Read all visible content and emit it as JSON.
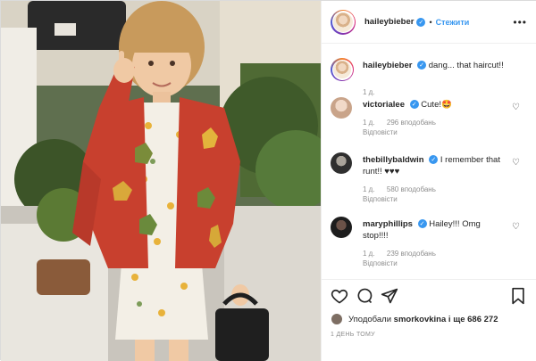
{
  "post": {
    "author": "haileybieber",
    "follow_label": "Стежити",
    "more_label": "•••",
    "caption": {
      "username": "haileybieber",
      "text": "dang... that haircut!!",
      "time": "1 д."
    },
    "comments": [
      {
        "username": "victorialee",
        "verified": true,
        "text": "Cute!🤩",
        "time": "1 д.",
        "likes": "296 вподобань",
        "reply": "Відповісти"
      },
      {
        "username": "thebillybaldwin",
        "verified": true,
        "text": "I remember that runt!! ♥♥♥",
        "time": "1 д.",
        "likes": "580 вподобань",
        "reply": "Відповісти"
      },
      {
        "username": "maryphillips",
        "verified": true,
        "text": "Hailey!!! Omg stop!!!!",
        "time": "1 д.",
        "likes": "239 вподобань",
        "reply": "Відповісти"
      }
    ],
    "likes_line": {
      "prefix": "Уподобали",
      "user": "smorkovkina",
      "suffix": "і ще 686 272"
    },
    "timestamp": "1 ДЕНЬ ТОМУ"
  },
  "colors": {
    "accent": "#3897f0",
    "text": "#262626",
    "muted": "#8e8e8e",
    "border": "#dbdbdb"
  },
  "icons": [
    "verified-badge-icon",
    "heart-icon",
    "comment-icon",
    "share-icon",
    "bookmark-icon",
    "more-icon"
  ]
}
